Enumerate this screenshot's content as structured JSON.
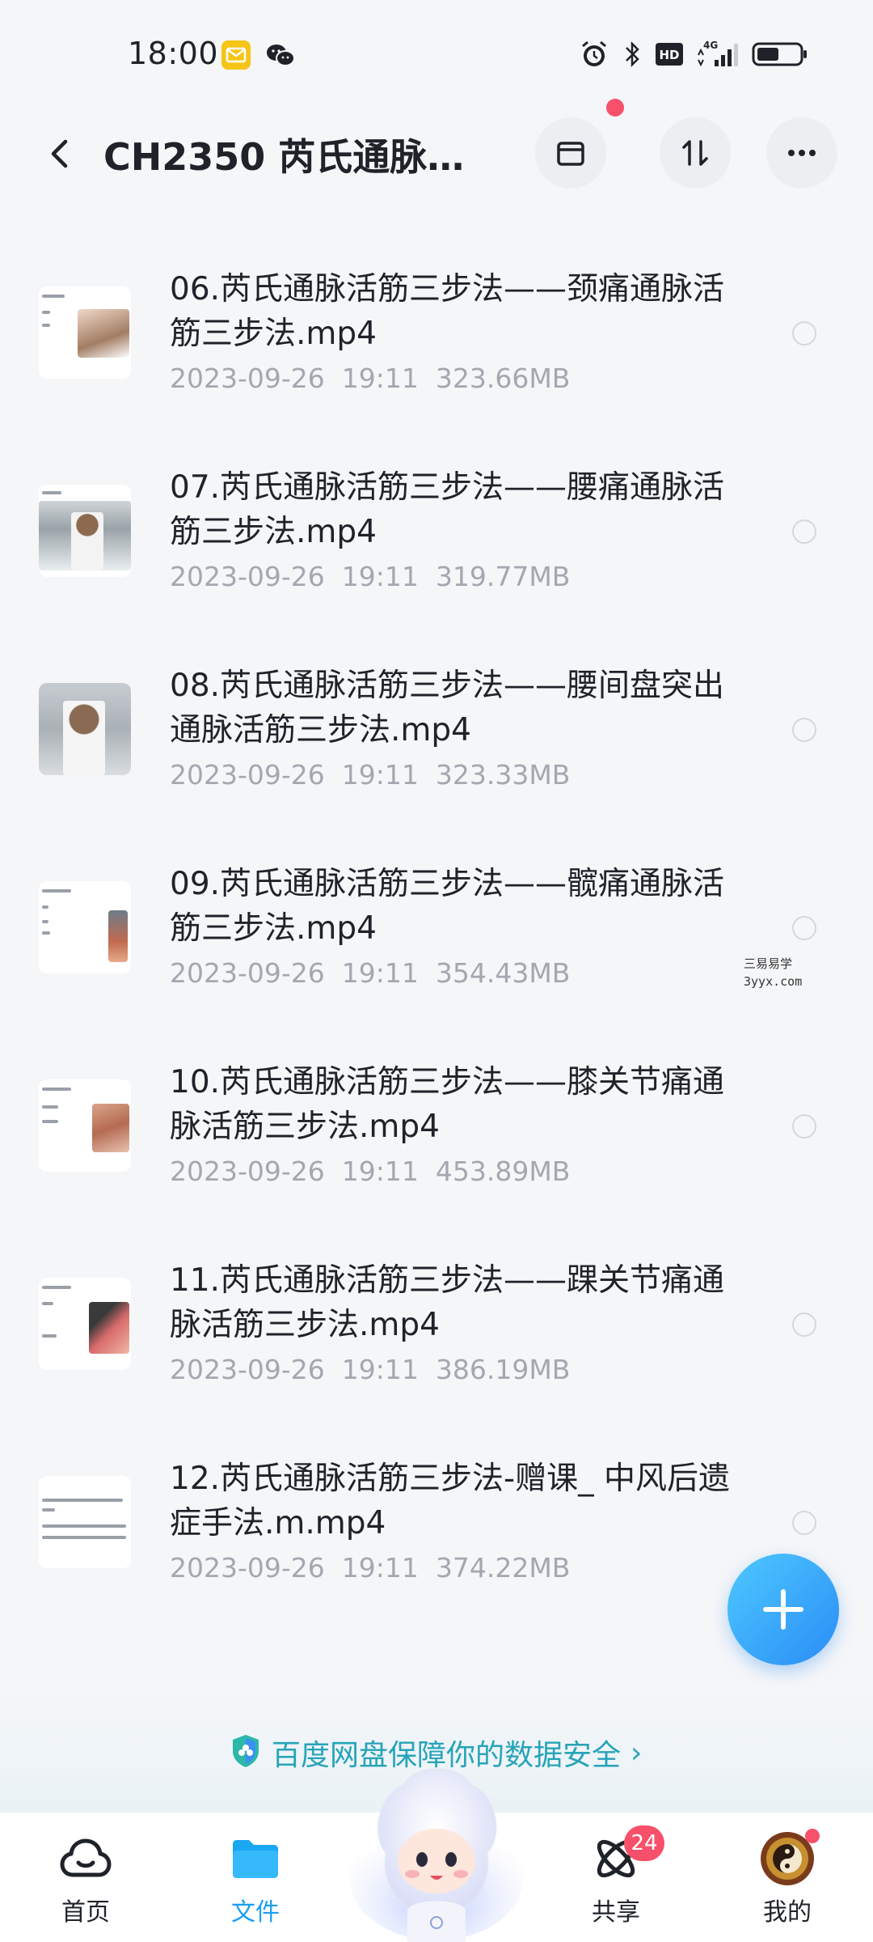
{
  "status_bar": {
    "time": "18:00",
    "icons": [
      "mail-app-icon",
      "wechat-icon",
      "alarm-icon",
      "bluetooth-icon",
      "hd-icon",
      "signal-4g-icon",
      "battery-icon"
    ],
    "hd_label": "HD",
    "network_label": "4G"
  },
  "header": {
    "title": "CH2350  芮氏通脉…",
    "buttons": [
      "archive-icon",
      "sort-icon",
      "more-icon"
    ]
  },
  "files": [
    {
      "name": "06.芮氏通脉活筋三步法——颈痛通脉活筋三步法.mp4",
      "date": "2023-09-26",
      "time": "19:11",
      "size": "323.66MB",
      "thumb": "neck"
    },
    {
      "name": "07.芮氏通脉活筋三步法——腰痛通脉活筋三步法.mp4",
      "date": "2023-09-26",
      "time": "19:11",
      "size": "319.77MB",
      "thumb": "presenter"
    },
    {
      "name": "08.芮氏通脉活筋三步法——腰间盘突出通脉活筋三步法.mp4",
      "date": "2023-09-26",
      "time": "19:11",
      "size": "323.33MB",
      "thumb": "presenter-full"
    },
    {
      "name": "09.芮氏通脉活筋三步法——髋痛通脉活筋三步法.mp4",
      "date": "2023-09-26",
      "time": "19:11",
      "size": "354.43MB",
      "thumb": "hip"
    },
    {
      "name": "10.芮氏通脉活筋三步法——膝关节痛通脉活筋三步法.mp4",
      "date": "2023-09-26",
      "time": "19:11",
      "size": "453.89MB",
      "thumb": "knee"
    },
    {
      "name": "11.芮氏通脉活筋三步法——踝关节痛通脉活筋三步法.mp4",
      "date": "2023-09-26",
      "time": "19:11",
      "size": "386.19MB",
      "thumb": "ankle"
    },
    {
      "name": "12.芮氏通脉活筋三步法-赠课_ 中风后遗症手法.m.mp4",
      "date": "2023-09-26",
      "time": "19:11",
      "size": "374.22MB",
      "thumb": "text"
    }
  ],
  "watermark": {
    "line1": "三易易学",
    "line2": "3yyx.com"
  },
  "banner": {
    "text": "百度网盘保障你的数据安全",
    "chevron": "›"
  },
  "nav": {
    "items": [
      {
        "label": "首页",
        "icon": "cloud-home-icon"
      },
      {
        "label": "文件",
        "icon": "folder-icon",
        "active": true
      },
      {
        "label": "共享",
        "icon": "atom-share-icon",
        "badge": "24"
      },
      {
        "label": "我的",
        "icon": "avatar-icon"
      }
    ]
  },
  "colors": {
    "accent": "#1a9ff0",
    "banner_text": "#26a4b8",
    "badge": "#f7506a",
    "meta": "#a3a8b0"
  }
}
